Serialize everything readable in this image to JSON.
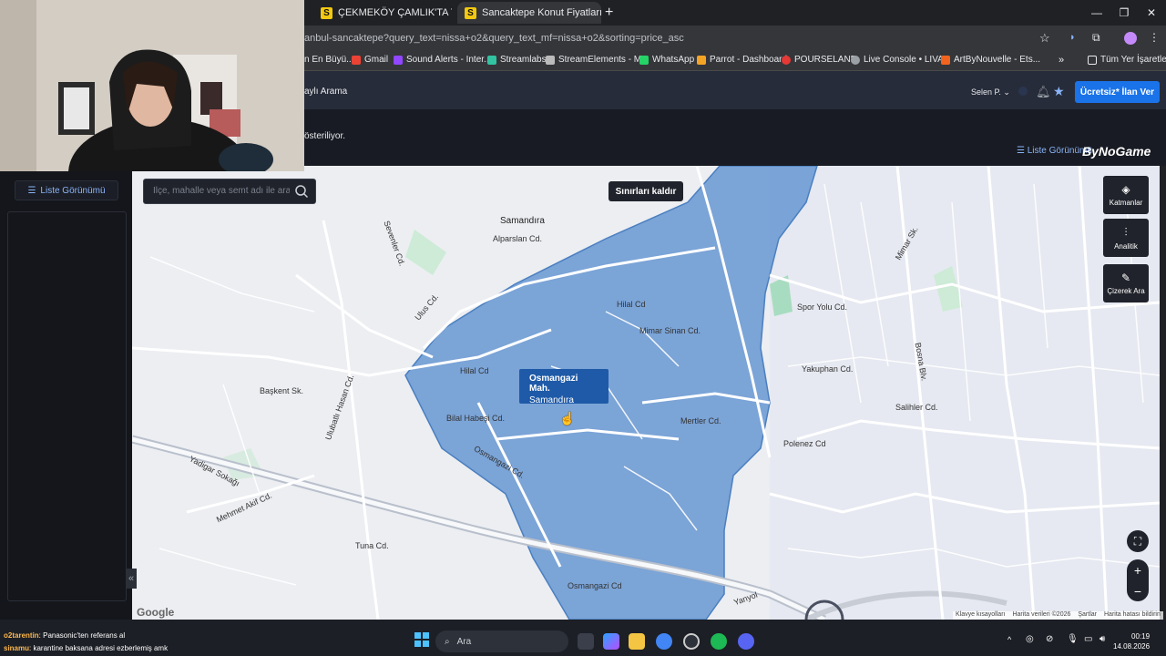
{
  "browser": {
    "tabs": [
      {
        "favicon": "S",
        "title": "ÇEKMEKÖY ÇAMLIK'TA TERASL"
      },
      {
        "favicon": "S",
        "title": "Sancaktepe Konut Fiyatları sahi"
      }
    ],
    "url": "anbul-sancaktepe?query_text=nissa+o2&query_text_mf=nissa+o2&sorting=price_asc",
    "bookmarks": [
      "n En Büyü...",
      "Gmail",
      "Sound Alerts - Inter...",
      "Streamlabs",
      "StreamElements - M...",
      "WhatsApp",
      "Parrot - Dashboard",
      "POURSELAND",
      "Live Console • LIVAD",
      "ArtByNouvelle - Ets..."
    ],
    "all_bookmarks": "Tüm Yer İşaretleri"
  },
  "app": {
    "title": "aylı Arama",
    "user": "Selen P.",
    "listing_button": "Ücretsiz* İlan Ver",
    "info_text": "österiliyor.",
    "list_view_top": "Liste Görünümü",
    "brand": "ByNoGame",
    "list_view_button": "Liste Görünümü"
  },
  "map": {
    "search_placeholder": "İlçe, mahalle veya semt adı ile ara",
    "clear_bounds": "Sınırları kaldır",
    "controls": {
      "layers": "Katmanlar",
      "analytics": "Analitik",
      "draw": "Çizerek Ara"
    },
    "popup": {
      "title": "Osmangazi Mah.",
      "subtitle": "Samandıra"
    },
    "labels": {
      "samandira": "Samandıra",
      "alparslan": "Alparslan Cd.",
      "hilal1": "Hilal Cd",
      "hilal2": "Hilal Cd",
      "mimarsinan": "Mimar Sinan Cd.",
      "bilalhabesi": "Bilal Habeşi Cd.",
      "osmangazi_cd": "Osmangazi Cd.",
      "mertler": "Mertler Cd.",
      "ulus": "Ulus Cd.",
      "baskent": "Başkent Sk.",
      "vadigar": "Yadigar Sokağı",
      "mehmetakif": "Mehmet Akif Cd.",
      "tuna": "Tuna Cd.",
      "osmangazi_cd2": "Osmangazi Cd",
      "yanyol": "Yanyol",
      "spor": "Spor Yolu Cd.",
      "yakuphan": "Yakuphan Cd.",
      "salihler": "Salihler Cd.",
      "polenez": "Polenez Cd",
      "bosna": "Bosna Blv.",
      "mimarsk": "Mimar Sk.",
      "ulubatli": "Ulubatlı Hasan Cd.",
      "sevenler": "Sevenler Cd."
    },
    "attribution": [
      "Klavye kısayolları",
      "Harita verileri ©2026",
      "Şartlar",
      "Harita hatası bildirin"
    ],
    "google": "Google",
    "colors": {
      "polygon": "#5b8fd0",
      "popup": "#1f5aa8",
      "accent": "#1a73e8"
    }
  },
  "chat": [
    {
      "user": "o2tarentin",
      "text": ": Panasonic'ten referans al"
    },
    {
      "user": "sinamu",
      "text": ": karantine baksana adresi ezberlemiş amk"
    }
  ],
  "taskbar": {
    "search": "Ara",
    "time": "00:19",
    "date": "14.08.2026"
  }
}
